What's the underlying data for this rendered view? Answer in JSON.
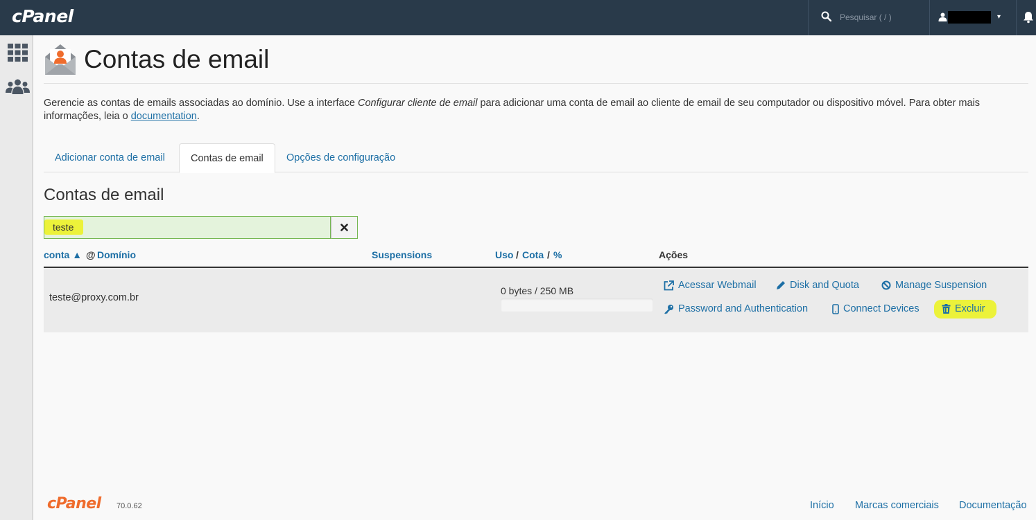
{
  "header": {
    "logo": "cPanel",
    "search_placeholder": "Pesquisar ( / )",
    "user_caret": "▾"
  },
  "page": {
    "title": "Contas de email",
    "description_1": "Gerencie as contas de emails associadas ao domínio. Use a interface ",
    "description_em": "Configurar cliente de email",
    "description_2": " para adicionar uma conta de email ao cliente de email de seu computador ou dispositivo móvel. Para obter mais informações, leia o ",
    "description_link": "documentation",
    "description_end": "."
  },
  "tabs": [
    {
      "label": "Adicionar conta de email"
    },
    {
      "label": "Contas de email"
    },
    {
      "label": "Opções de configuração"
    }
  ],
  "section": {
    "title": "Contas de email",
    "filter_value": "teste"
  },
  "table": {
    "col_account": "conta ▲",
    "col_at": "@",
    "col_domain": "Domínio",
    "col_suspensions": "Suspensions",
    "col_uso": "Uso",
    "col_sep1": "/",
    "col_cota": "Cota",
    "col_sep2": "/",
    "col_pct": "%",
    "col_actions": "Ações",
    "row": {
      "account": "teste@proxy.com.br",
      "usage": "0 bytes / 250 MB",
      "usage_fraction": 0,
      "actions": {
        "webmail": "Acessar Webmail",
        "disk": "Disk and Quota",
        "suspension": "Manage Suspension",
        "password": "Password and Authentication",
        "devices": "Connect Devices",
        "delete": "Excluir"
      }
    }
  },
  "footer": {
    "logo": "cPanel",
    "version": "70.0.62",
    "links": [
      "Início",
      "Marcas comerciais",
      "Documentação"
    ]
  },
  "colors": {
    "topbar": "#293a4a",
    "link": "#1d6fa5",
    "highlight": "#ecf23a",
    "brand_orange": "#ef6c2d"
  }
}
